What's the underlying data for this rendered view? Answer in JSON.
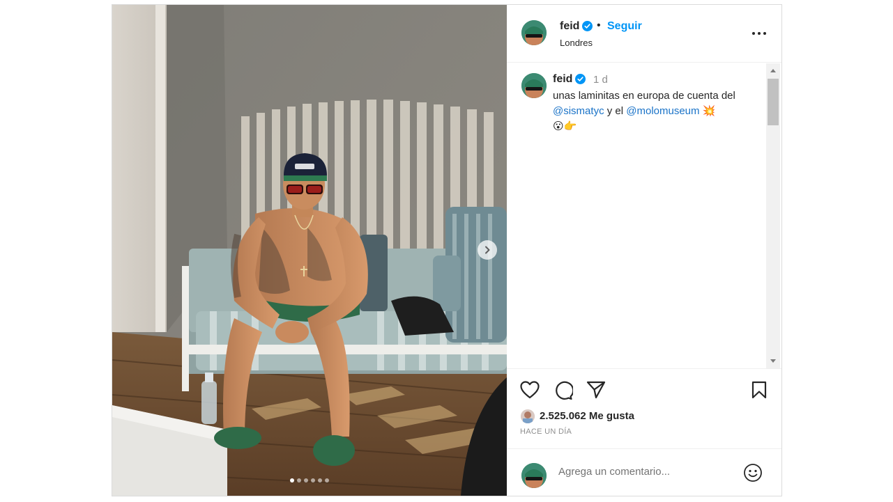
{
  "header": {
    "username": "feid",
    "separator": "•",
    "follow_label": "Seguir",
    "location": "Londres",
    "more_icon": "more-horizontal-icon"
  },
  "caption": {
    "username": "feid",
    "time": "1 d",
    "text_before": "unas laminitas en europa de cuenta del",
    "mention_1": "@sismatyc",
    "connector": "y el",
    "mention_2": "@molomuseum",
    "emoji_1": "💥",
    "emoji_2": "😮",
    "emoji_3": "👉"
  },
  "actions": {
    "like_icon": "heart-icon",
    "comment_icon": "comment-icon",
    "share_icon": "paper-plane-icon",
    "save_icon": "bookmark-icon"
  },
  "likes": {
    "count_text": "2.525.062 Me gusta",
    "time_ago": "HACE UN DÍA"
  },
  "comment_box": {
    "placeholder": "Agrega un comentario...",
    "emoji_icon": "smiley-icon"
  },
  "carousel": {
    "total_slides": 6,
    "active_slide": 1,
    "next_icon": "chevron-right-icon"
  },
  "colors": {
    "accent": "#0095f6",
    "verified": "#0095f6",
    "muted": "#8e8e8e",
    "text": "#262626"
  }
}
